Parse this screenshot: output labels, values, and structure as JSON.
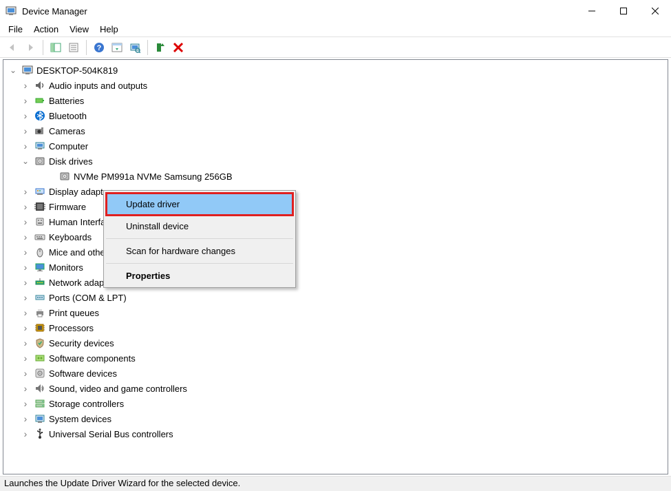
{
  "window": {
    "title": "Device Manager",
    "minimize": "Minimize",
    "maximize": "Maximize",
    "close": "Close"
  },
  "menubar": {
    "items": [
      "File",
      "Action",
      "View",
      "Help"
    ]
  },
  "toolbar": {
    "back": "Back",
    "forward": "Forward",
    "show_hide": "Show/Hide Console Tree",
    "properties": "Properties",
    "help": "Help",
    "action_list": "Action list",
    "scan": "Scan for hardware changes",
    "update": "Update driver",
    "uninstall": "Uninstall device"
  },
  "tree": {
    "root": {
      "label": "DESKTOP-504K819",
      "expanded": true
    },
    "children": [
      {
        "label": "Audio inputs and outputs",
        "expanded": false,
        "icon": "audio"
      },
      {
        "label": "Batteries",
        "expanded": false,
        "icon": "battery"
      },
      {
        "label": "Bluetooth",
        "expanded": false,
        "icon": "bluetooth"
      },
      {
        "label": "Cameras",
        "expanded": false,
        "icon": "camera"
      },
      {
        "label": "Computer",
        "expanded": false,
        "icon": "computer"
      },
      {
        "label": "Disk drives",
        "expanded": true,
        "icon": "disk",
        "children": [
          {
            "label": "NVMe PM991a NVMe Samsung 256GB",
            "icon": "disk"
          }
        ]
      },
      {
        "label": "Display adapters",
        "expanded": false,
        "icon": "display-adapter"
      },
      {
        "label": "Firmware",
        "expanded": false,
        "icon": "firmware"
      },
      {
        "label": "Human Interface Devices",
        "expanded": false,
        "icon": "hid"
      },
      {
        "label": "Keyboards",
        "expanded": false,
        "icon": "keyboard"
      },
      {
        "label": "Mice and other pointing devices",
        "expanded": false,
        "icon": "mouse"
      },
      {
        "label": "Monitors",
        "expanded": false,
        "icon": "monitor"
      },
      {
        "label": "Network adapters",
        "expanded": false,
        "icon": "network"
      },
      {
        "label": "Ports (COM & LPT)",
        "expanded": false,
        "icon": "port"
      },
      {
        "label": "Print queues",
        "expanded": false,
        "icon": "printer"
      },
      {
        "label": "Processors",
        "expanded": false,
        "icon": "cpu"
      },
      {
        "label": "Security devices",
        "expanded": false,
        "icon": "security"
      },
      {
        "label": "Software components",
        "expanded": false,
        "icon": "component"
      },
      {
        "label": "Software devices",
        "expanded": false,
        "icon": "software"
      },
      {
        "label": "Sound, video and game controllers",
        "expanded": false,
        "icon": "sound"
      },
      {
        "label": "Storage controllers",
        "expanded": false,
        "icon": "storage"
      },
      {
        "label": "System devices",
        "expanded": false,
        "icon": "system"
      },
      {
        "label": "Universal Serial Bus controllers",
        "expanded": false,
        "icon": "usb"
      }
    ]
  },
  "context_menu": {
    "update_driver": "Update driver",
    "uninstall_device": "Uninstall device",
    "scan_hardware": "Scan for hardware changes",
    "properties": "Properties"
  },
  "statusbar": {
    "text": "Launches the Update Driver Wizard for the selected device."
  }
}
